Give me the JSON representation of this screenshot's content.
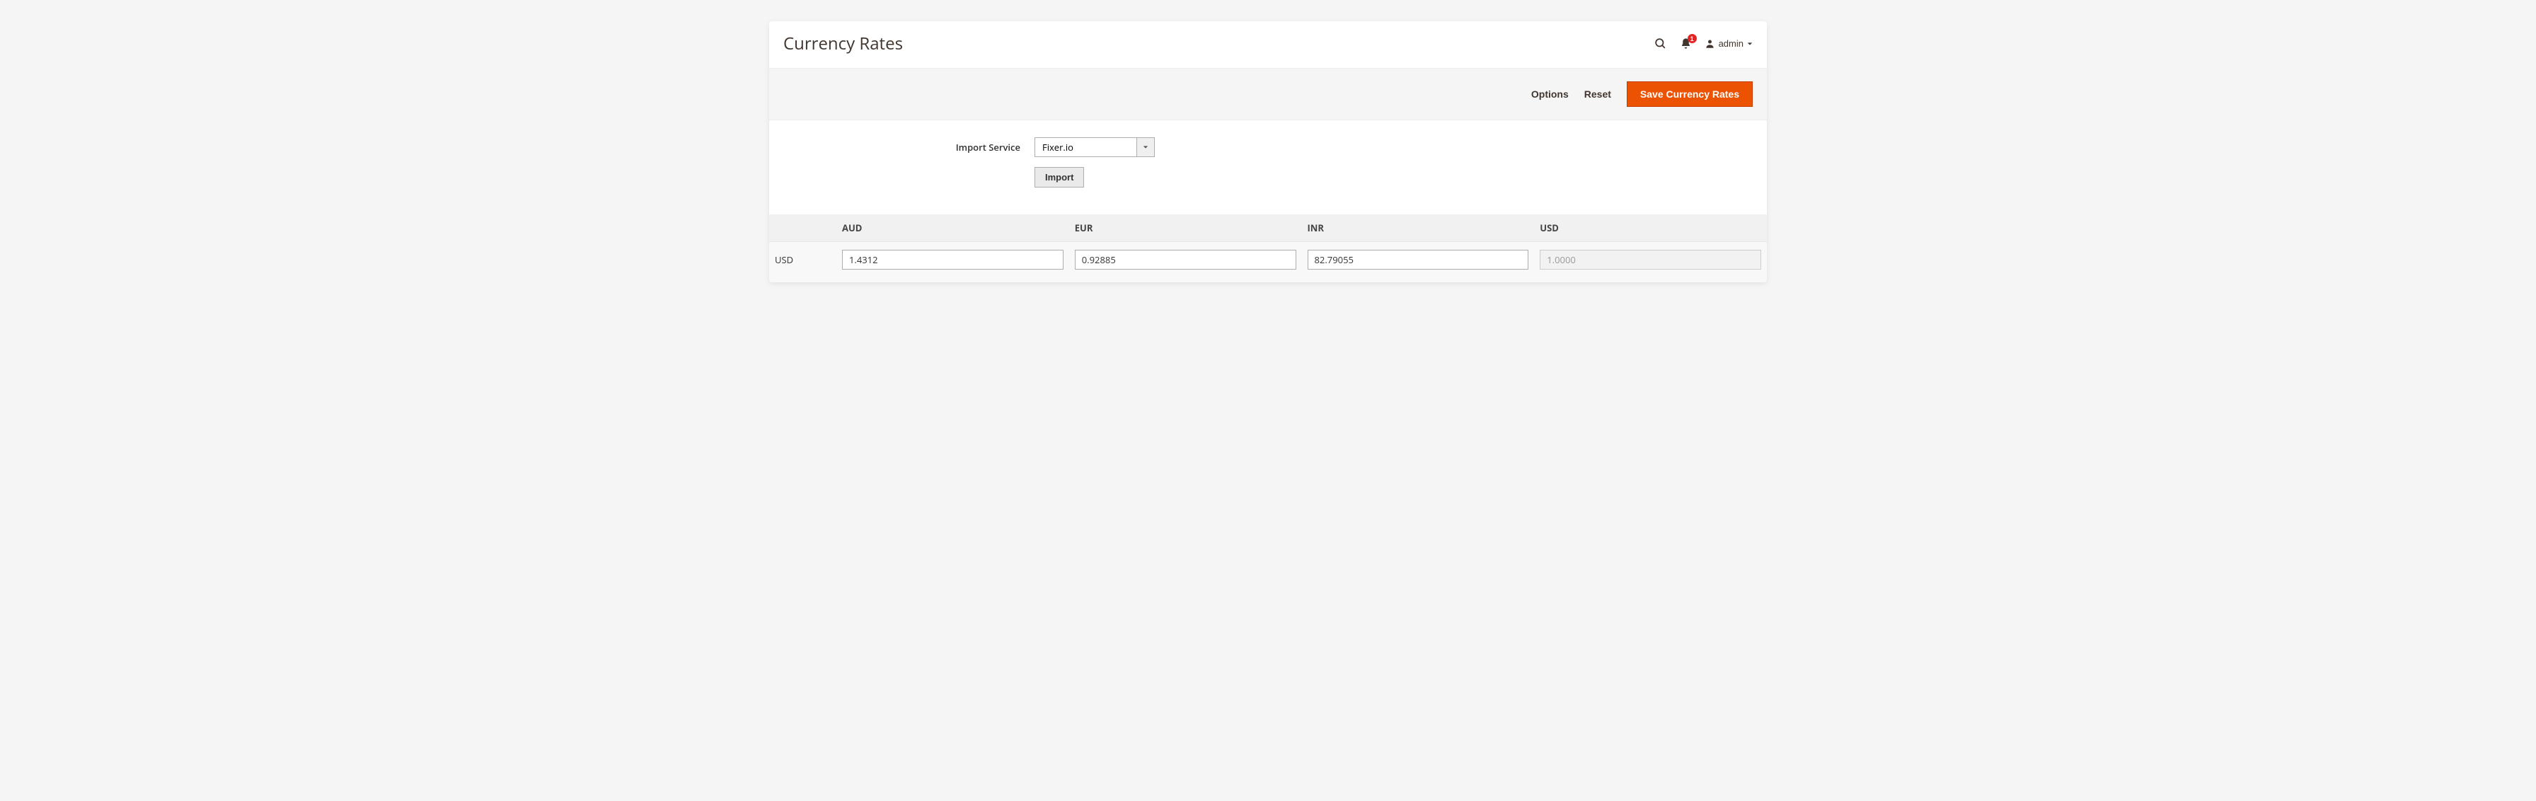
{
  "page": {
    "title": "Currency Rates"
  },
  "header": {
    "notification_count": "1",
    "user_label": "admin"
  },
  "actions": {
    "options": "Options",
    "reset": "Reset",
    "save": "Save Currency Rates"
  },
  "import": {
    "label": "Import Service",
    "selected": "Fixer.io",
    "button": "Import"
  },
  "table": {
    "columns": [
      "AUD",
      "EUR",
      "INR",
      "USD"
    ],
    "rows": [
      {
        "base": "USD",
        "rates": {
          "AUD": "1.4312",
          "EUR": "0.92885",
          "INR": "82.79055",
          "USD": "1.0000"
        },
        "disabled": [
          "USD"
        ]
      }
    ]
  }
}
